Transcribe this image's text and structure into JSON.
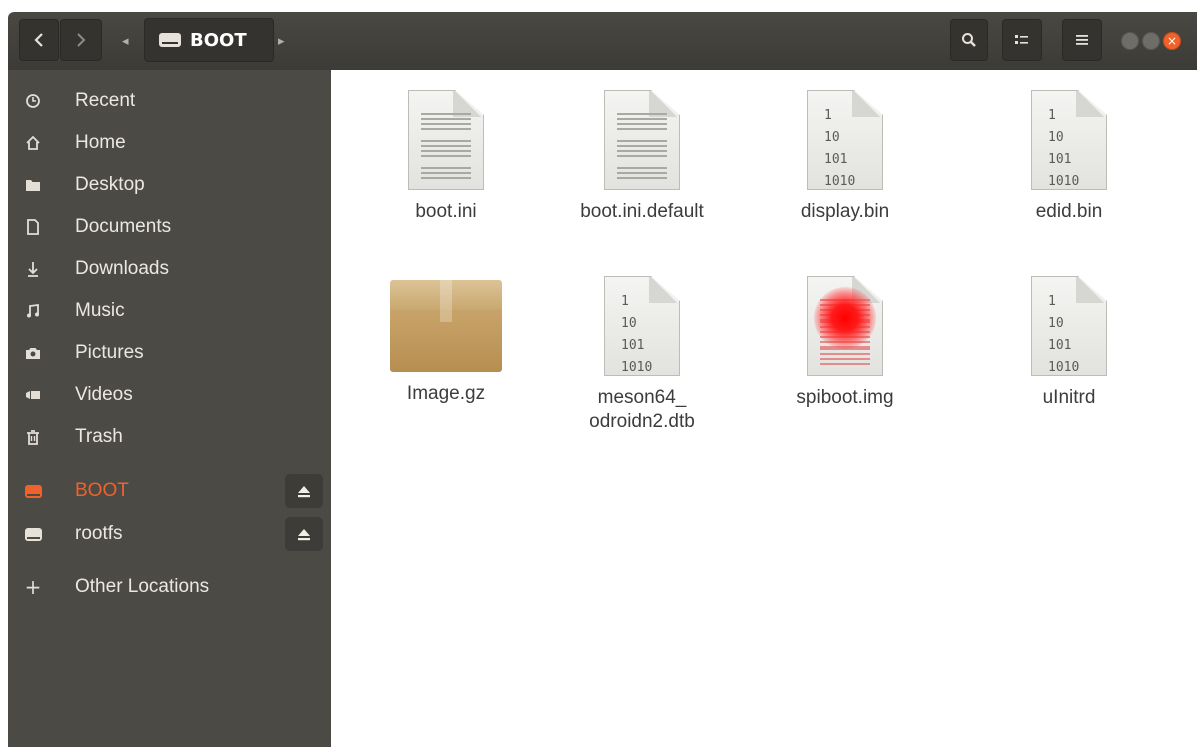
{
  "header": {
    "location": "BOOT",
    "back_icon": "chevron-left-icon",
    "forward_icon": "chevron-right-icon",
    "search_icon": "search-icon",
    "view_icon": "view-options-icon",
    "menu_icon": "hamburger-menu-icon",
    "accent_close": "#f0622c"
  },
  "sidebar": {
    "items": [
      {
        "label": "Recent",
        "icon": "clock-icon"
      },
      {
        "label": "Home",
        "icon": "home-icon"
      },
      {
        "label": "Desktop",
        "icon": "folder-icon"
      },
      {
        "label": "Documents",
        "icon": "document-icon"
      },
      {
        "label": "Downloads",
        "icon": "download-icon"
      },
      {
        "label": "Music",
        "icon": "music-icon"
      },
      {
        "label": "Pictures",
        "icon": "camera-icon"
      },
      {
        "label": "Videos",
        "icon": "video-icon"
      },
      {
        "label": "Trash",
        "icon": "trash-icon"
      }
    ],
    "drives": [
      {
        "label": "BOOT",
        "icon": "drive-icon",
        "active": true
      },
      {
        "label": "rootfs",
        "icon": "drive-icon",
        "active": false
      }
    ],
    "other": {
      "label": "Other Locations",
      "icon": "plus-icon"
    }
  },
  "files": [
    {
      "name": "boot.ini",
      "kind": "text"
    },
    {
      "name": "boot.ini.default",
      "kind": "text"
    },
    {
      "name": "display.bin",
      "kind": "binary"
    },
    {
      "name": "edid.bin",
      "kind": "binary"
    },
    {
      "name": "Image.gz",
      "kind": "archive"
    },
    {
      "name": "meson64_\nodroidn2.dtb",
      "kind": "binary"
    },
    {
      "name": "spiboot.img",
      "kind": "image"
    },
    {
      "name": "uInitrd",
      "kind": "binary"
    }
  ],
  "binary_glyph": "1\n10\n101\n1010"
}
